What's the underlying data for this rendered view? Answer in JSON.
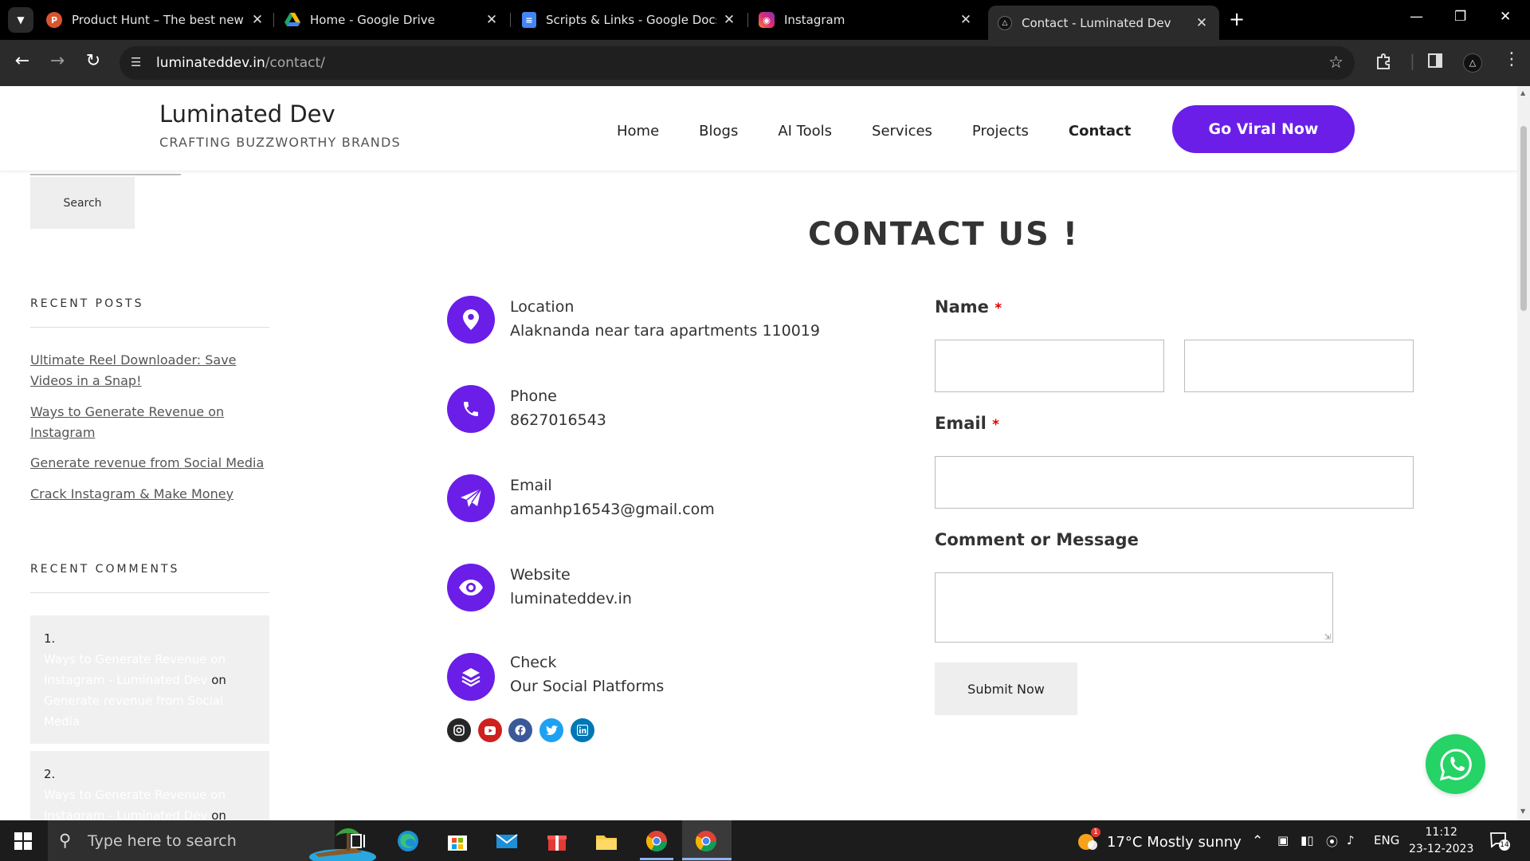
{
  "browser": {
    "tabs": [
      {
        "title": "Product Hunt – The best new pr",
        "favicon": "product-hunt-icon",
        "color": "#da552f"
      },
      {
        "title": "Home - Google Drive",
        "favicon": "google-drive-icon",
        "color": "#1fa463"
      },
      {
        "title": "Scripts & Links - Google Docs",
        "favicon": "google-docs-icon",
        "color": "#4285f4"
      },
      {
        "title": "Instagram",
        "favicon": "instagram-icon",
        "color": "#e1306c"
      },
      {
        "title": "Contact - Luminated Dev",
        "favicon": "luminated-dev-icon",
        "color": "#000000",
        "active": true
      }
    ],
    "url_host": "luminateddev.in",
    "url_path": "/contact/"
  },
  "site": {
    "title": "Luminated Dev",
    "tagline": "CRAFTING BUZZWORTHY BRANDS",
    "nav": [
      "Home",
      "Blogs",
      "AI Tools",
      "Services",
      "Projects",
      "Contact"
    ],
    "nav_current": "Contact",
    "cta": "Go Viral Now",
    "accent": "#6a1ee8"
  },
  "sidebar": {
    "search_button": "Search",
    "recent_posts_title": "RECENT POSTS",
    "recent_posts": [
      "Ultimate Reel Downloader: Save Videos in a Snap!",
      "Ways to Generate Revenue on Instagram",
      "Generate revenue from Social Media",
      "Crack Instagram & Make Money"
    ],
    "recent_comments_title": "RECENT COMMENTS",
    "comments": [
      {
        "num": "1.",
        "author": "Ways to Generate Revenue on Instagram - Luminated Dev",
        "on": "on",
        "post": "Generate revenue from Social Media"
      },
      {
        "num": "2.",
        "author": "Ways to Generate Revenue on Instagram - Luminated Dev",
        "on": "on"
      }
    ]
  },
  "contact": {
    "heading": "CONTACT US !",
    "items": [
      {
        "label": "Location",
        "value": "Alaknanda near tara apartments 110019",
        "icon": "location-pin-icon"
      },
      {
        "label": "Phone",
        "value": "8627016543",
        "icon": "phone-icon"
      },
      {
        "label": "Email",
        "value": "amanhp16543@gmail.com",
        "icon": "paper-plane-icon"
      },
      {
        "label": "Website",
        "value": "luminateddev.in",
        "icon": "eye-icon"
      },
      {
        "label": "Check",
        "value": "Our Social Platforms",
        "icon": "layers-icon"
      }
    ],
    "socials": [
      {
        "name": "instagram-icon",
        "color": "#262626"
      },
      {
        "name": "youtube-icon",
        "color": "#cd201f"
      },
      {
        "name": "facebook-icon",
        "color": "#3b5998"
      },
      {
        "name": "twitter-icon",
        "color": "#1da1f2"
      },
      {
        "name": "linkedin-icon",
        "color": "#0077b5"
      }
    ]
  },
  "form": {
    "name_label": "Name",
    "email_label": "Email",
    "message_label": "Comment or Message",
    "required_mark": "*",
    "submit": "Submit Now"
  },
  "taskbar": {
    "search_placeholder": "Type here to search",
    "weather": "17°C  Mostly sunny",
    "weather_badge": "1",
    "language": "ENG",
    "time": "11:12",
    "date": "23-12-2023",
    "notifications": "14"
  }
}
